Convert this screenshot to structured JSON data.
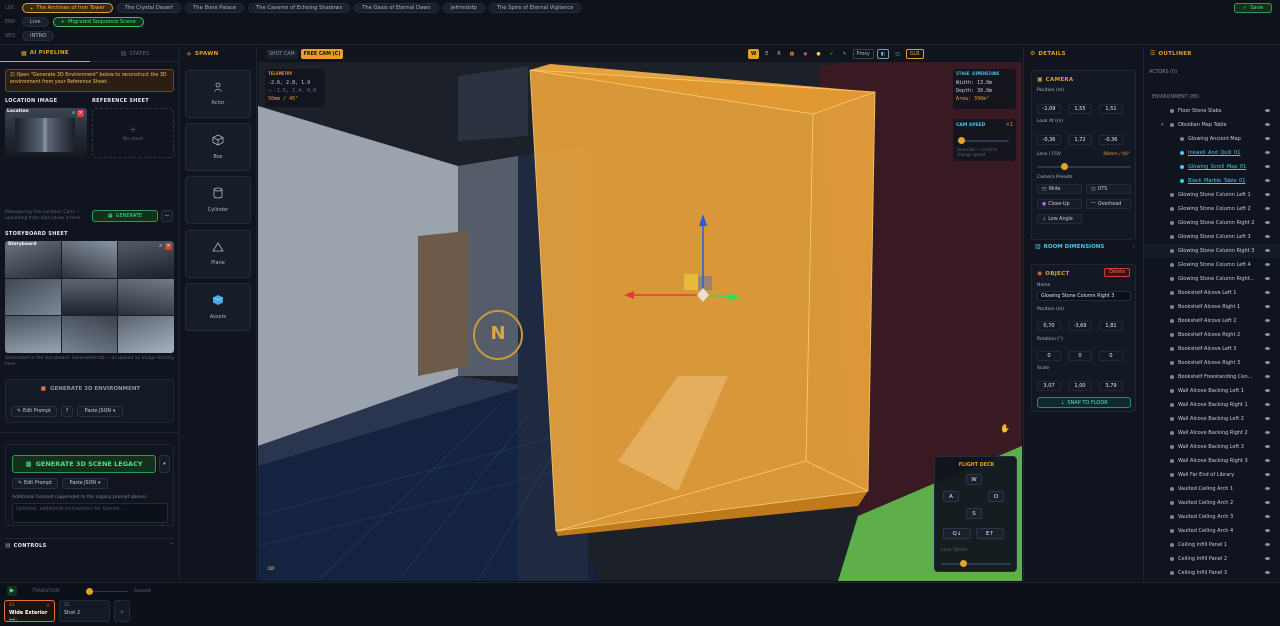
{
  "topbar": {
    "loc_label": "LOC",
    "env_label": "ENV",
    "seq_label": "SEQ",
    "locations": [
      "The Archives of Iron Tower",
      "The Crystal Desert",
      "The Bone Palace",
      "The Caverns of Echoing Shadows",
      "The Oasis of Eternal Dawn",
      "jefrmidsfp",
      "The Spire of Eternal Vigilance"
    ],
    "env_items": [
      "Live",
      "Migrated Sequence Scene"
    ],
    "seq_items": [
      "INTRO"
    ],
    "save": "Save"
  },
  "left": {
    "tab_ai": "AI PIPELINE",
    "tab_states": "STATES",
    "notice": "2) Open \"Generate 3D Environment\" below to reconstruct the 3D environment from your Reference Sheet.",
    "location_image": "LOCATION IMAGE",
    "reference_sheet": "REFERENCE SHEET",
    "location_thumb_label": "Location",
    "no_sheet": "No sheet",
    "managed_note": "Managed by the Location Card — uploading from dips saves it here",
    "generate": "GENERATE",
    "storyboard": "STORYBOARD SHEET",
    "storyboard_thumb_label": "Storyboard",
    "storyboard_note": "Generated in the storyboard. Generated tab — or upload an image directly here.",
    "gen3d": "GENERATE 3D ENVIRONMENT",
    "edit_prompt": "Edit Prompt",
    "paste_json": "Paste JSON",
    "gen_legacy": "GENERATE 3D SCENE LEGACY",
    "edit_prompt2": "Edit Prompt",
    "paste_json2": "Paste JSON",
    "additional": "Additional Context (appended to the Legacy prompt above)",
    "placeholder": "Optional: additional instructions for Gemini...",
    "controls": "CONTROLS"
  },
  "spawn": {
    "title": "SPAWN",
    "items": [
      "Actor",
      "Box",
      "Cylinder",
      "Plane",
      "Assets"
    ]
  },
  "viewport": {
    "shot_cam": "SHOT CAM",
    "free_cam": "FREE CAM (C)",
    "toolbar": [
      "W",
      "E",
      "R",
      "Proxy",
      "GLB"
    ],
    "telemetry_title": "TELEMETRY",
    "telemetry_l1": "-2.6, 2.8, 1.9",
    "telemetry_l2": "→ -1.5, 1.4, 0.0",
    "telemetry_l3": "50mm / 45°",
    "stage_title": "STAGE DIMENSIONS",
    "stage_width": "Width: 13.0m",
    "stage_depth": "Depth: 30.0m",
    "stage_area": "Area: 390m²",
    "cam_speed": "CAM SPEED",
    "cam_speed_val": "×1",
    "cam_speed_hint": "slow  fast — scroll to change speed",
    "compass": "N",
    "flight_title": "FLIGHT DECK",
    "keys": [
      "W",
      "A",
      "D",
      "S",
      "Q↓",
      "E↑"
    ],
    "lens": "Lens 50mm"
  },
  "details": {
    "title": "DETAILS",
    "camera": "CAMERA",
    "position_lbl": "Position (m)",
    "position": [
      "-1,09",
      "1,55",
      "1,51"
    ],
    "lookat_lbl": "Look At (m)",
    "lookat": [
      "-0,36",
      "1,72",
      "-0,36"
    ],
    "lens_lbl": "Lens / FOV",
    "lens_val": "48mm / 40°",
    "presets_lbl": "Camera Presets",
    "presets": [
      "Wide",
      "OTS",
      "Close-Up",
      "Overhead",
      "Low Angle"
    ],
    "room_dims": "ROOM DIMENSIONS",
    "object": "OBJECT",
    "delete": "Delete",
    "name_lbl": "Name",
    "name_val": "Glowing Stone Column Right 3",
    "obj_pos_lbl": "Position (m)",
    "obj_pos": [
      "0,70",
      "-3,69",
      "1,81"
    ],
    "rot_lbl": "Rotation (°)",
    "rot": [
      "0",
      "0",
      "0"
    ],
    "scale_lbl": "Scale",
    "scale": [
      "3,07",
      "1,00",
      "3,79"
    ],
    "snap": "SNAP TO FLOOR"
  },
  "outliner": {
    "title": "OUTLINER",
    "actors": "ACTORS (0)",
    "environment": "ENVIRONMENT (88)",
    "items": [
      "Floor Stone Slabs",
      "Obsidian Map Table",
      "Glowing Ancient Map",
      "Inkwell_And_Quill_01",
      "Glowing_Scroll_Map_01",
      "Black_Marble_Table_01",
      "Glowing Stone Column Left 1",
      "Glowing Stone Column Left 2",
      "Glowing Stone Column Right 2",
      "Glowing Stone Column Left 3",
      "Glowing Stone Column Right 3",
      "Glowing Stone Column Left 4",
      "Glowing Stone Column Right...",
      "Bookshelf Alcove Left 1",
      "Bookshelf Alcove Right 1",
      "Bookshelf Alcove Left 2",
      "Bookshelf Alcove Right 2",
      "Bookshelf Alcove Left 3",
      "Bookshelf Alcove Right 3",
      "Bookshelf Freestanding Cen...",
      "Wall Alcove Backing Left 1",
      "Wall Alcove Backing Right 1",
      "Wall Alcove Backing Left 2",
      "Wall Alcove Backing Right 2",
      "Wall Alcove Backing Left 3",
      "Wall Alcove Backing Right 3",
      "Wall Far End of Library",
      "Vaulted Ceiling Arch 1",
      "Vaulted Ceiling Arch 2",
      "Vaulted Ceiling Arch 3",
      "Vaulted Ceiling Arch 4",
      "Ceiling Infill Panel 1",
      "Ceiling Infill Panel 2",
      "Ceiling Infill Panel 3"
    ]
  },
  "bottom": {
    "transition": "TRANSITION",
    "smooth": "Smooth",
    "shot1_id": "S1",
    "shot1_name": "Wide Exterior ...",
    "shot1_dur": "2.0s",
    "shot2_id": "S2",
    "shot2_name": "Shot 2",
    "add": "+"
  },
  "colors": {
    "accent": "#e4a02a",
    "green": "#36c46a",
    "cyan": "#48c8ea",
    "danger": "#d93b3b"
  }
}
